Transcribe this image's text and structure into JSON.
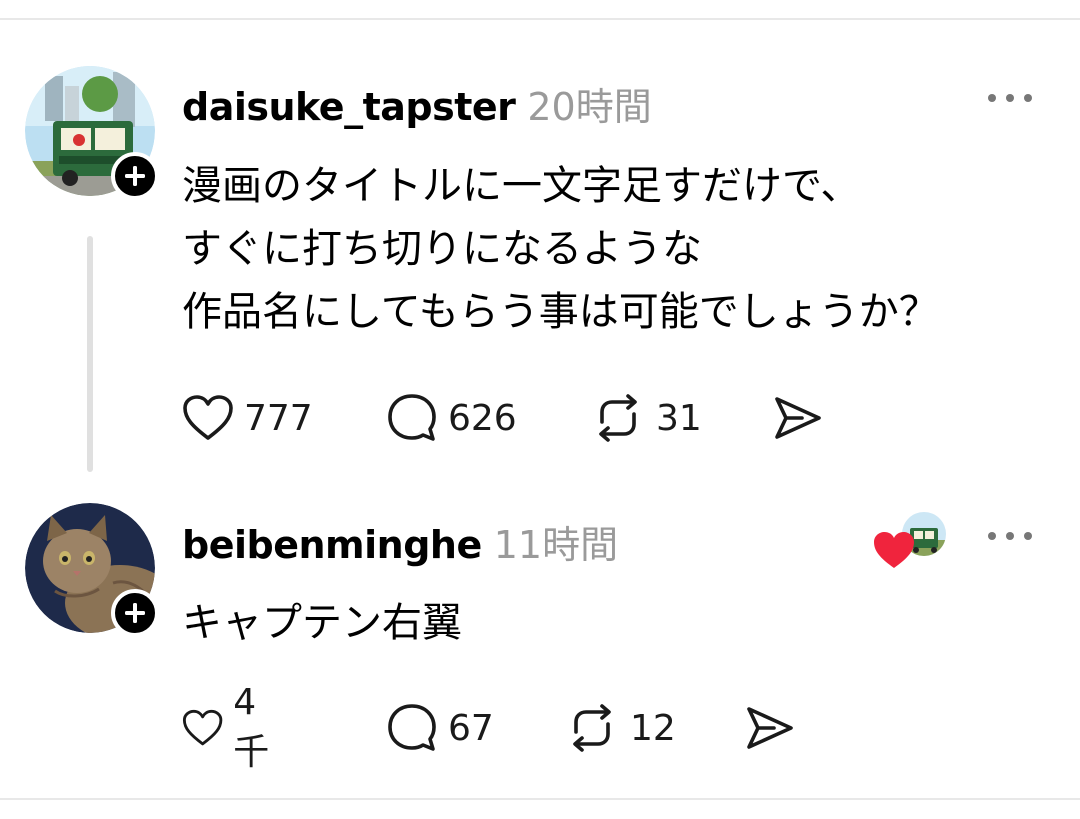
{
  "posts": [
    {
      "username": "daisuke_tapster",
      "time": "20時間",
      "body": [
        "漫画のタイトルに一文字足すだけで、",
        "すぐに打ち切りになるような",
        "作品名にしてもらう事は可能でしょうか？"
      ],
      "likes": "777",
      "replies": "626",
      "reposts": "31"
    },
    {
      "username": "beibenminghe",
      "time": "11時間",
      "body": [
        "キャプテン右翼"
      ],
      "likes": "4千",
      "replies": "67",
      "reposts": "12"
    }
  ],
  "colors": {
    "text": "#000000",
    "muted": "#9a9a9a",
    "heart": "#f0243d",
    "thread_line": "#e0e0e0"
  },
  "icons": [
    "heart-icon",
    "comment-icon",
    "repost-icon",
    "share-icon",
    "more-icon",
    "plus-icon"
  ]
}
